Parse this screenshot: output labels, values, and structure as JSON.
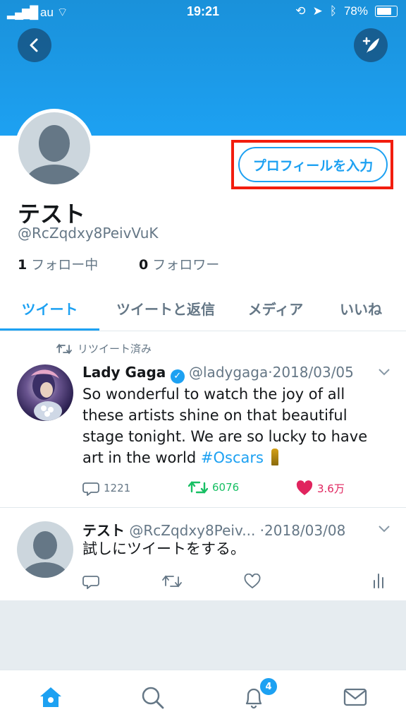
{
  "status_bar": {
    "carrier": "au",
    "time": "19:21",
    "battery": "78%"
  },
  "profile": {
    "edit_button_label": "プロフィールを入力",
    "name": "テスト",
    "handle": "@RcZqdxy8PeivVuK",
    "following_count": "1",
    "following_label": "フォロー中",
    "followers_count": "0",
    "followers_label": "フォロワー"
  },
  "tabs": [
    {
      "label": "ツイート"
    },
    {
      "label": "ツイートと返信"
    },
    {
      "label": "メディア"
    },
    {
      "label": "いいね"
    }
  ],
  "tweets": [
    {
      "retweet_note": "リツイート済み",
      "name": "Lady Gaga",
      "handle": "@ladygaga",
      "date": "·2018/03/05",
      "text_lines": [
        "So wonderful to watch the joy of all",
        "these artists shine on that beautiful",
        "stage tonight. We are so lucky to have",
        "art in the world "
      ],
      "hashtag": "#Oscars",
      "replies": "1221",
      "retweets": "6076",
      "likes": "3.6万"
    },
    {
      "name": "テスト",
      "handle": "@RcZqdxy8Peiv...",
      "date": "·2018/03/08",
      "text": "試しにツイートをする。"
    }
  ],
  "tabbar": {
    "notification_badge": "4"
  },
  "colors": {
    "accent": "#1da1f2",
    "retweet": "#17bf63",
    "like": "#e0245e",
    "highlight": "#f21d0e"
  }
}
